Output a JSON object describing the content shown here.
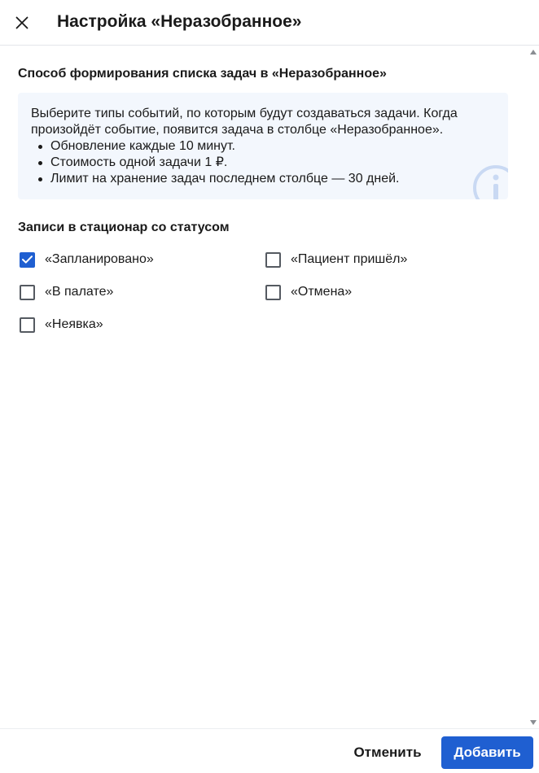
{
  "header": {
    "title": "Настройка «Неразобранное»",
    "close_icon": "close-icon"
  },
  "section": {
    "title": "Способ формирования списка задач в «Неразобранное»"
  },
  "info": {
    "text": "Выберите типы событий, по которым будут создаваться задачи. Когда произойдёт событие, появится задача в столбце «Неразобранное».",
    "bullets": [
      "Обновление каждые 10 минут.",
      "Стоимость одной задачи 1 ₽.",
      "Лимит на хранение задач последнем столбце — 30 дней."
    ],
    "icon": "info-icon"
  },
  "statuses": {
    "title": "Записи в стационар со статусом",
    "items": [
      {
        "label": "«Запланировано»",
        "checked": true
      },
      {
        "label": "«Пациент пришёл»",
        "checked": false
      },
      {
        "label": "«В палате»",
        "checked": false
      },
      {
        "label": "«Отмена»",
        "checked": false
      },
      {
        "label": "«Неявка»",
        "checked": false
      }
    ]
  },
  "footer": {
    "cancel_label": "Отменить",
    "add_label": "Добавить"
  },
  "colors": {
    "accent": "#1f5fd1",
    "info_background": "#f3f7fd",
    "info_icon": "#c9d9f3"
  }
}
